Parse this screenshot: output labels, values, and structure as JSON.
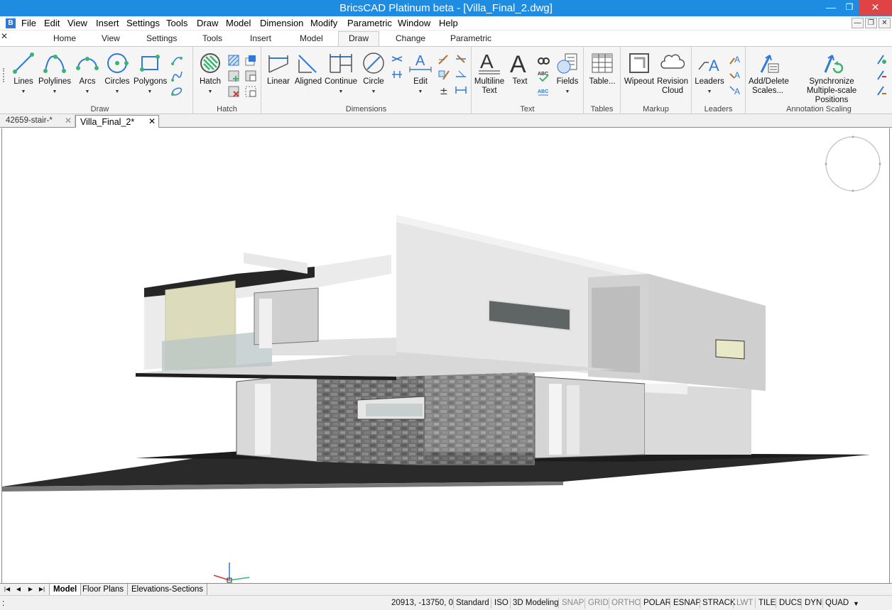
{
  "window": {
    "title": "BricsCAD Platinum beta - [Villa_Final_2.dwg]",
    "min_glyph": "—",
    "max_glyph": "❐",
    "close_glyph": "✕",
    "app_icon_glyph": "B"
  },
  "menu": {
    "items": [
      "File",
      "Edit",
      "View",
      "Insert",
      "Settings",
      "Tools",
      "Draw",
      "Model",
      "Dimension",
      "Modify",
      "Parametric",
      "Window",
      "Help"
    ],
    "mdi": [
      "—",
      "❐",
      "✕"
    ]
  },
  "ribbon_tabs": {
    "close_glyph": "✕",
    "items": [
      "Home",
      "View",
      "Settings",
      "Tools",
      "Insert",
      "Model",
      "Draw",
      "Change",
      "Parametric"
    ],
    "active": "Draw"
  },
  "ribbon": {
    "draw": {
      "label": "Draw",
      "lines": "Lines",
      "polylines": "Polylines",
      "arcs": "Arcs",
      "circles": "Circles",
      "polygons": "Polygons"
    },
    "hatch": {
      "label": "Hatch",
      "hatch": "Hatch"
    },
    "dimensions": {
      "label": "Dimensions",
      "linear": "Linear",
      "aligned": "Aligned",
      "continue": "Continue",
      "circle": "Circle",
      "edit": "Edit"
    },
    "text": {
      "label": "Text",
      "multiline_1": "Multiline",
      "multiline_2": "Text",
      "text": "Text",
      "fields": "Fields"
    },
    "tables": {
      "label": "Tables",
      "table": "Table..."
    },
    "markup": {
      "label": "Markup",
      "wipeout": "Wipeout",
      "revision_1": "Revision",
      "revision_2": "Cloud"
    },
    "leaders": {
      "label": "Leaders",
      "leaders": "Leaders"
    },
    "annotation_scaling": {
      "label": "Annotation Scaling",
      "add_1": "Add/Delete",
      "add_2": "Scales...",
      "sync_1": "Synchronize",
      "sync_2": "Multiple-scale Positions"
    },
    "accent": "#2f7ad8",
    "green": "#3cb371"
  },
  "doc_tabs": [
    {
      "label": "42659-stair-*",
      "close": "✕"
    },
    {
      "label": "Villa_Final_2*",
      "close": "✕"
    }
  ],
  "layout_tabs": {
    "nav": [
      "|◀",
      "◀",
      "▶",
      "▶|"
    ],
    "items": [
      "Model",
      "Floor Plans",
      "Elevations-Sections"
    ]
  },
  "status": {
    "prompt": ":",
    "coords": "20913, -13750, 0",
    "items": [
      "Standard",
      "ISO",
      "3D Modeling",
      "SNAP",
      "GRID",
      "ORTHO",
      "POLAR",
      "ESNAP",
      "STRACK",
      "LWT",
      "TILE",
      "DUCS",
      "DYN",
      "QUAD"
    ],
    "off_items": [
      "SNAP",
      "GRID",
      "ORTHO",
      "LWT"
    ],
    "menu_glyph": "▼"
  }
}
